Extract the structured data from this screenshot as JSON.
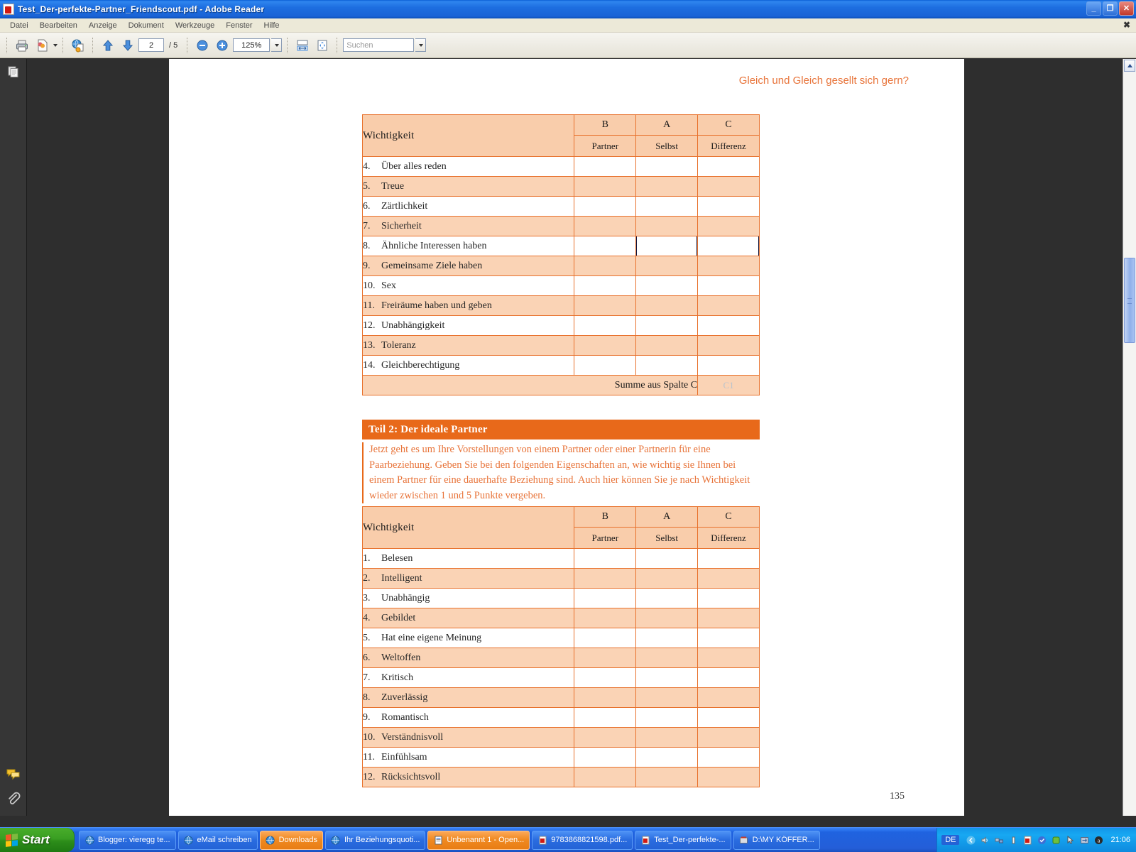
{
  "window": {
    "title": "Test_Der-perfekte-Partner_Friendscout.pdf - Adobe Reader",
    "icon": "pdf-document-icon",
    "minimize": "_",
    "maximize": "❐",
    "close": "✕",
    "mdi_close": "✖"
  },
  "menubar": {
    "items": [
      {
        "label": "Datei"
      },
      {
        "label": "Bearbeiten"
      },
      {
        "label": "Anzeige"
      },
      {
        "label": "Dokument"
      },
      {
        "label": "Werkzeuge"
      },
      {
        "label": "Fenster"
      },
      {
        "label": "Hilfe"
      }
    ]
  },
  "toolbar": {
    "print": "print-icon",
    "save_copy": "save-copy-icon",
    "web_capture": "web-capture-icon",
    "prev_page": "arrow-up-icon",
    "next_page": "arrow-down-icon",
    "current_page": "2",
    "page_total": "/ 5",
    "zoom_out": "zoom-out-icon",
    "zoom_in": "zoom-in-icon",
    "zoom_level": "125%",
    "fit_width": "fit-width-icon",
    "fit_page": "fit-page-icon",
    "search_placeholder": "Suchen",
    "search_value": ""
  },
  "navpanel": {
    "pages_icon": "pages-thumbnail-icon",
    "comments_icon": "comments-icon",
    "attachments_icon": "paperclip-icon"
  },
  "document": {
    "running_header": "Gleich und Gleich gesellt sich gern?",
    "page_number": "135",
    "table1": {
      "header_label": "Wichtigkeit",
      "columns_top": [
        "B",
        "A",
        "C"
      ],
      "columns_sub": [
        "Partner",
        "Selbst",
        "Differenz"
      ],
      "rows": [
        {
          "num": "4.",
          "label": "Über alles reden"
        },
        {
          "num": "5.",
          "label": "Treue"
        },
        {
          "num": "6.",
          "label": "Zärtlichkeit"
        },
        {
          "num": "7.",
          "label": "Sicherheit"
        },
        {
          "num": "8.",
          "label": "Ähnliche Interessen haben"
        },
        {
          "num": "9.",
          "label": "Gemeinsame Ziele haben"
        },
        {
          "num": "10.",
          "label": "Sex"
        },
        {
          "num": "11.",
          "label": "Freiräume haben und geben"
        },
        {
          "num": "12.",
          "label": "Unabhängigkeit"
        },
        {
          "num": "13.",
          "label": "Toleranz"
        },
        {
          "num": "14.",
          "label": "Gleichberechtigung"
        }
      ],
      "sum_label": "Summe aus Spalte C",
      "sum_value": "C1"
    },
    "section2": {
      "bar_title": "Teil 2: Der ideale Partner",
      "paragraph": "Jetzt geht es um Ihre Vorstellungen von einem Partner oder einer Partnerin für eine Paarbeziehung. Geben Sie bei den folgenden Eigenschaften an, wie wichtig sie Ihnen bei einem Partner für eine dauerhafte Beziehung sind. Auch hier können Sie je nach Wichtigkeit wieder zwischen 1 und 5 Punkte vergeben."
    },
    "table2": {
      "header_label": "Wichtigkeit",
      "columns_top": [
        "B",
        "A",
        "C"
      ],
      "columns_sub": [
        "Partner",
        "Selbst",
        "Differenz"
      ],
      "rows": [
        {
          "num": "1.",
          "label": "Belesen"
        },
        {
          "num": "2.",
          "label": "Intelligent"
        },
        {
          "num": "3.",
          "label": "Unabhängig"
        },
        {
          "num": "4.",
          "label": "Gebildet"
        },
        {
          "num": "5.",
          "label": "Hat eine eigene Meinung"
        },
        {
          "num": "6.",
          "label": "Weltoffen"
        },
        {
          "num": "7.",
          "label": "Kritisch"
        },
        {
          "num": "8.",
          "label": "Zuverlässig"
        },
        {
          "num": "9.",
          "label": "Romantisch"
        },
        {
          "num": "10.",
          "label": "Verständnisvoll"
        },
        {
          "num": "11.",
          "label": "Einfühlsam"
        },
        {
          "num": "12.",
          "label": "Rücksichtsvoll"
        }
      ]
    }
  },
  "taskbar": {
    "start_label": "Start",
    "tasks": [
      {
        "label": "Blogger: vieregg te...",
        "icon": "browser-icon",
        "active": false
      },
      {
        "label": "eMail schreiben",
        "icon": "browser-icon",
        "active": false
      },
      {
        "label": "Downloads",
        "icon": "browser-icon",
        "active": true
      },
      {
        "label": "Ihr Beziehungsquoti...",
        "icon": "browser-icon",
        "active": false
      },
      {
        "label": "Unbenannt 1 - Open...",
        "icon": "openoffice-icon",
        "active": true
      },
      {
        "label": "9783868821598.pdf...",
        "icon": "pdf-icon",
        "active": false
      },
      {
        "label": "Test_Der-perfekte-...",
        "icon": "pdf-icon",
        "active": false
      },
      {
        "label": "D:\\MY KÖFFER...",
        "icon": "explorer-icon",
        "active": false
      }
    ],
    "language": "DE",
    "tray_icons": [
      "show-hidden-icon",
      "volume-icon",
      "network-icon",
      "battery-icon",
      "acrobat-icon",
      "update-icon",
      "antivirus-icon",
      "cursor-icon",
      "sync-icon",
      "info-icon"
    ],
    "clock": "21:06"
  },
  "colors": {
    "pdf_accent": "#e8691a",
    "table_fill": "#fad3b5",
    "table_header_fill": "#f9cdab",
    "table_border": "#e8712c",
    "taskbar_blue": "#2463d6",
    "active_task": "#e87d14"
  }
}
